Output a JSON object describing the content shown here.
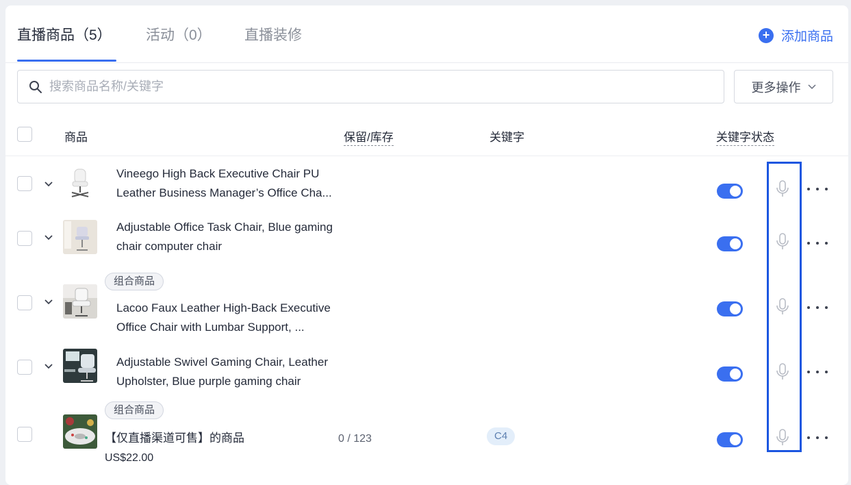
{
  "tabs": [
    {
      "label": "直播商品（5）",
      "active": true
    },
    {
      "label": "活动（0）",
      "active": false
    },
    {
      "label": "直播装修",
      "active": false
    }
  ],
  "add_button": {
    "label": "添加商品",
    "icon": "plus-circle-icon"
  },
  "search": {
    "placeholder": "搜索商品名称/关键字",
    "value": "",
    "icon": "search-icon"
  },
  "more_actions": {
    "label": "更多操作",
    "icon": "chevron-down-icon"
  },
  "table": {
    "columns": [
      "商品",
      "保留/库存",
      "关键字",
      "关键字状态"
    ],
    "rows": [
      {
        "name": "Vineego High Back Executive Chair PU Leather Business Manager’s Office Cha...",
        "tag": "",
        "stock": "",
        "keyword": "",
        "price": "",
        "keyword_enabled": true,
        "expandable": true
      },
      {
        "name": "Adjustable Office Task Chair, Blue gaming chair computer chair",
        "tag": "",
        "stock": "",
        "keyword": "",
        "price": "",
        "keyword_enabled": true,
        "expandable": true
      },
      {
        "name": "Lacoo Faux Leather High-Back Executive Office Chair with Lumbar Support, ...",
        "tag": "组合商品",
        "stock": "",
        "keyword": "",
        "price": "",
        "keyword_enabled": true,
        "expandable": true
      },
      {
        "name": "Adjustable Swivel Gaming Chair, Leather Upholster, Blue purple gaming chair",
        "tag": "",
        "stock": "",
        "keyword": "",
        "price": "",
        "keyword_enabled": true,
        "expandable": true
      },
      {
        "name": "【仅直播渠道可售】的商品",
        "tag": "组合商品",
        "stock": "0 / 123",
        "keyword": "C4",
        "price": "US$22.00",
        "keyword_enabled": true,
        "expandable": false
      }
    ]
  },
  "colors": {
    "accent": "#3a6ff0",
    "highlight_box": "#1b56e0",
    "keyword_tag_bg": "#e3eefa"
  }
}
